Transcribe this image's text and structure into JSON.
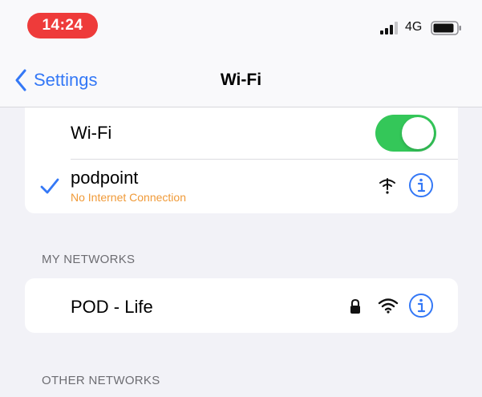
{
  "status_bar": {
    "time": "14:24",
    "network_type": "4G",
    "time_pill_color": "#ee3b3a"
  },
  "nav": {
    "back_label": "Settings",
    "title": "Wi-Fi",
    "accent": "#3478f6"
  },
  "wifi_toggle": {
    "label": "Wi-Fi",
    "on": true,
    "color": "#34c759"
  },
  "connected_network": {
    "name": "podpoint",
    "status": "No Internet Connection",
    "status_color": "#f09a38",
    "icons": [
      "checkmark-icon",
      "no-internet-wifi-icon",
      "info-icon"
    ]
  },
  "sections": {
    "my_networks": "MY NETWORKS",
    "other_networks": "OTHER NETWORKS"
  },
  "my_networks": [
    {
      "name": "POD - Life",
      "icons": [
        "lock-icon",
        "wifi-icon",
        "info-icon"
      ]
    }
  ]
}
